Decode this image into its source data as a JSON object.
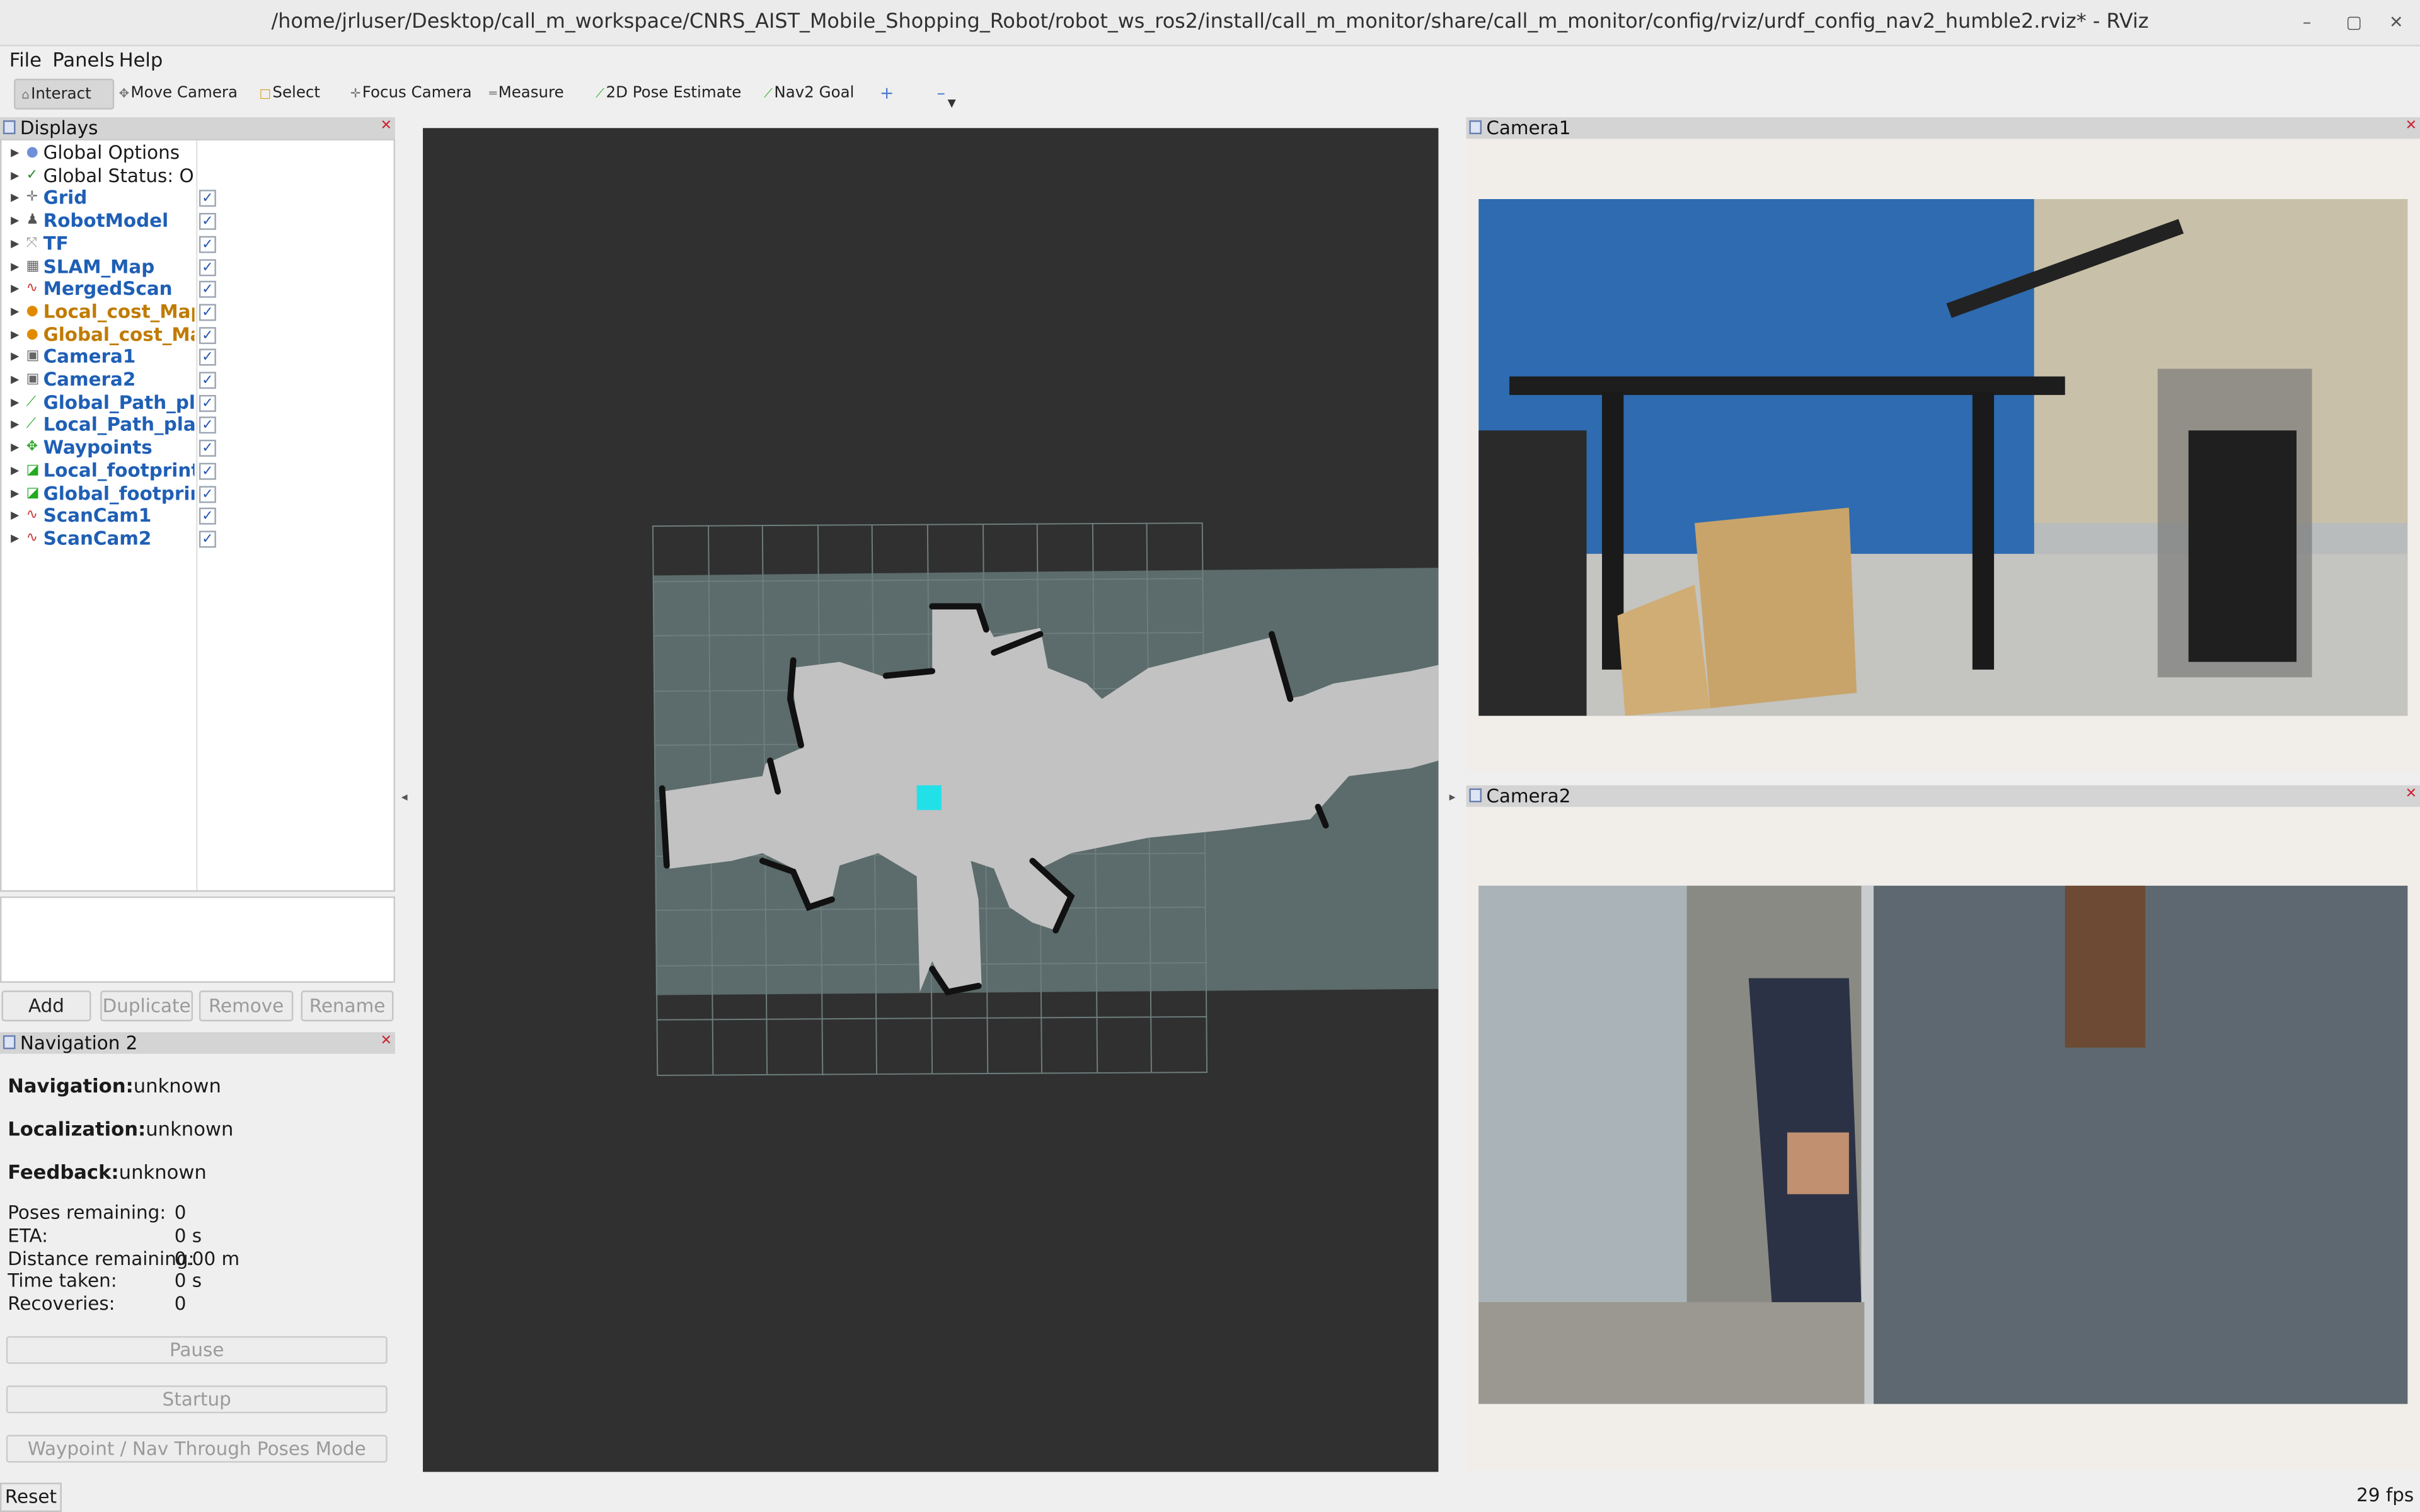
{
  "window": {
    "title": "/home/jrluser/Desktop/call_m_workspace/CNRS_AIST_Mobile_Shopping_Robot/robot_ws_ros2/install/call_m_monitor/share/call_m_monitor/config/rviz/urdf_config_nav2_humble2.rviz* - RViz",
    "controls": {
      "minimize": "–",
      "maximize": "▢",
      "close": "✕"
    }
  },
  "menubar": {
    "file": "File",
    "panels": "Panels",
    "help": "Help"
  },
  "toolbar": {
    "interact": "Interact",
    "move_camera": "Move Camera",
    "select": "Select",
    "focus_camera": "Focus Camera",
    "measure": "Measure",
    "pose_estimate": "2D Pose Estimate",
    "nav2_goal": "Nav2 Goal",
    "plus": "+",
    "minus": "–"
  },
  "displays": {
    "title": "Displays",
    "items": [
      {
        "label": "Global Options",
        "style": "plain",
        "icon": "●",
        "icon_color": "#6f8fd8",
        "checked": null
      },
      {
        "label": "Global Status: Ok",
        "style": "plain",
        "icon": "✓",
        "icon_color": "#2b8a2b",
        "checked": null
      },
      {
        "label": "Grid",
        "style": "b",
        "icon": "✛",
        "icon_color": "#777",
        "checked": true
      },
      {
        "label": "RobotModel",
        "style": "b",
        "icon": "♟",
        "icon_color": "#555",
        "checked": true
      },
      {
        "label": "TF",
        "style": "b",
        "icon": "⤧",
        "icon_color": "#999",
        "checked": true
      },
      {
        "label": "SLAM_Map",
        "style": "b",
        "icon": "▦",
        "icon_color": "#666",
        "checked": true
      },
      {
        "label": "MergedScan",
        "style": "b",
        "icon": "∿",
        "icon_color": "#c33",
        "checked": true
      },
      {
        "label": "Local_cost_Map",
        "style": "o",
        "icon": "●",
        "icon_color": "#e08a00",
        "checked": true
      },
      {
        "label": "Global_cost_Map",
        "style": "o",
        "icon": "●",
        "icon_color": "#e08a00",
        "checked": true
      },
      {
        "label": "Camera1",
        "style": "b",
        "icon": "▣",
        "icon_color": "#666",
        "checked": true
      },
      {
        "label": "Camera2",
        "style": "b",
        "icon": "▣",
        "icon_color": "#666",
        "checked": true
      },
      {
        "label": "Global_Path_pl...",
        "style": "b",
        "icon": "⟋",
        "icon_color": "#2a2",
        "checked": true
      },
      {
        "label": "Local_Path_pla...",
        "style": "b",
        "icon": "⟋",
        "icon_color": "#2a2",
        "checked": true
      },
      {
        "label": "Waypoints",
        "style": "b",
        "icon": "✥",
        "icon_color": "#3a3",
        "checked": true
      },
      {
        "label": "Local_footprint",
        "style": "b",
        "icon": "◪",
        "icon_color": "#2a2",
        "checked": true
      },
      {
        "label": "Global_footprint",
        "style": "b",
        "icon": "◪",
        "icon_color": "#2a2",
        "checked": true
      },
      {
        "label": "ScanCam1",
        "style": "b",
        "icon": "∿",
        "icon_color": "#c33",
        "checked": true
      },
      {
        "label": "ScanCam2",
        "style": "b",
        "icon": "∿",
        "icon_color": "#c33",
        "checked": true
      }
    ],
    "buttons": {
      "add": "Add",
      "duplicate": "Duplicate",
      "remove": "Remove",
      "rename": "Rename"
    }
  },
  "navigation": {
    "title": "Navigation 2",
    "navigation_label": "Navigation:",
    "navigation_value": "unknown",
    "localization_label": "Localization:",
    "localization_value": "unknown",
    "feedback_label": "Feedback:",
    "feedback_value": "unknown",
    "stats": [
      {
        "label": "Poses remaining:",
        "value": "0"
      },
      {
        "label": "ETA:",
        "value": "0 s"
      },
      {
        "label": "Distance remaining:",
        "value": "0.00 m"
      },
      {
        "label": "Time taken:",
        "value": "0 s"
      },
      {
        "label": "Recoveries:",
        "value": "0"
      }
    ],
    "pause": "Pause",
    "startup": "Startup",
    "waypoint_mode": "Waypoint / Nav Through Poses Mode"
  },
  "cameras": {
    "camera1": "Camera1",
    "camera2": "Camera2"
  },
  "status": {
    "reset": "Reset",
    "fps": "29 fps"
  }
}
